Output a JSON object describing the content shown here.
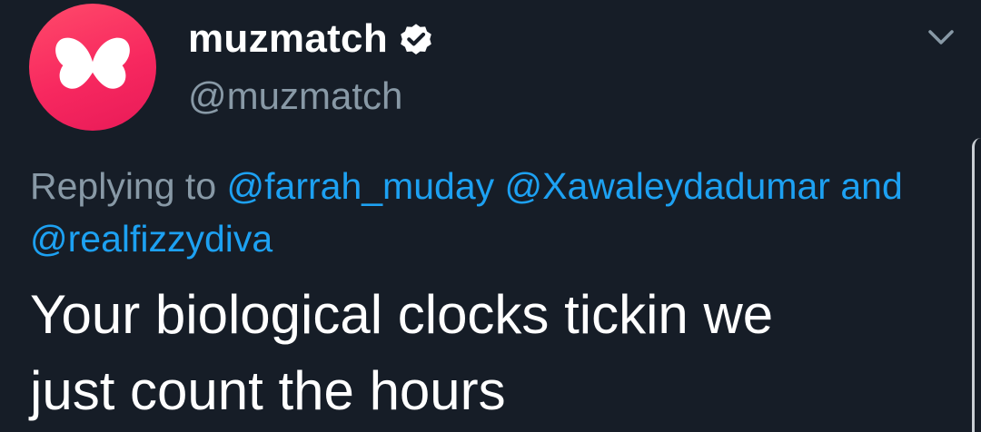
{
  "tweet": {
    "author": {
      "display_name": "muzmatch",
      "handle": "@muzmatch",
      "verified": true,
      "avatar_icon": "butterfly-logo",
      "avatar_color": "#f7285f"
    },
    "menu_icon": "chevron-down-icon",
    "reply_context": {
      "prefix": "Replying to",
      "mentions": [
        "@farrah_muday",
        "@Xawaleydadumar",
        "@realfizzydiva"
      ],
      "conjunction": "and"
    },
    "text_line1": "Your biological clocks tickin we",
    "text_line2": "just count the hours"
  },
  "colors": {
    "background": "#161d27",
    "link": "#1da1f2",
    "muted": "#8899a6",
    "text": "#ffffff"
  }
}
